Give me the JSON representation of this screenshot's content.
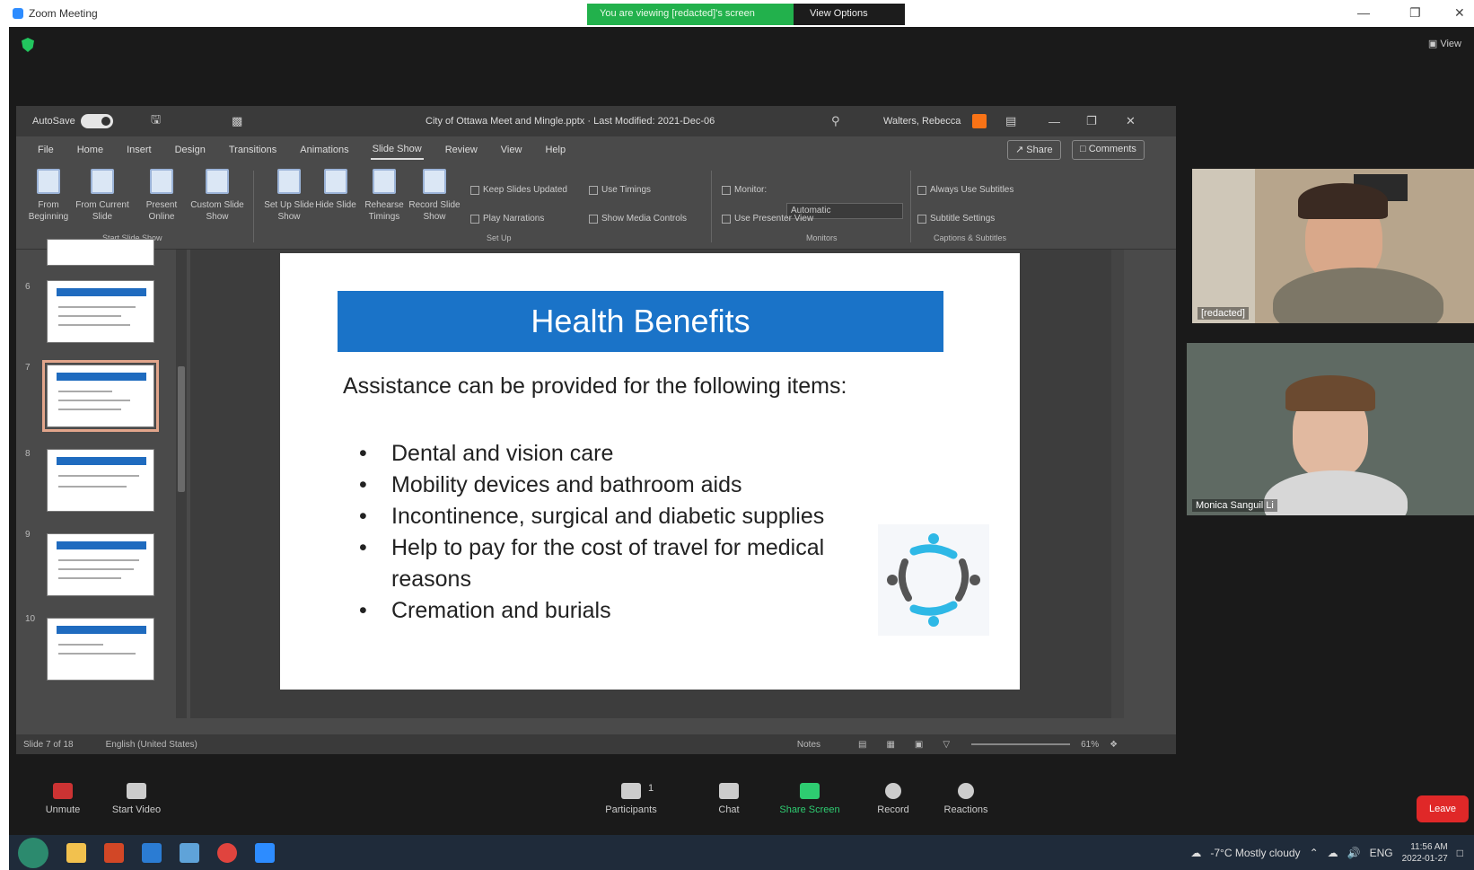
{
  "zoom": {
    "window_title": "Zoom Meeting",
    "share_banner": "You are viewing [redacted]'s screen",
    "view_options": "View Options",
    "view_button": "View",
    "leave": "Leave"
  },
  "ppt": {
    "autosave_label": "AutoSave",
    "autosave_state": "On",
    "doc_name": "City of Ottawa Meet and Mingle.pptx · Last Modified: 2021-Dec-06",
    "user_name": "Walters, Rebecca",
    "tabs": [
      "File",
      "Home",
      "Insert",
      "Design",
      "Transitions",
      "Animations",
      "Slide Show",
      "Review",
      "View",
      "Help"
    ],
    "active_tab": "Slide Show",
    "share_label": "Share",
    "comments_label": "Comments",
    "ribbon": {
      "start": [
        {
          "label": "From Beginning"
        },
        {
          "label": "From Current Slide"
        },
        {
          "label": "Present Online"
        },
        {
          "label": "Custom Slide Show"
        }
      ],
      "setup": [
        {
          "label": "Set Up Slide Show"
        },
        {
          "label": "Hide Slide"
        },
        {
          "label": "Rehearse Timings"
        },
        {
          "label": "Record Slide Show"
        }
      ],
      "checks": {
        "keep_updated": "Keep Slides Updated",
        "use_timings": "Use Timings",
        "play_narrations": "Play Narrations",
        "show_media_controls": "Show Media Controls",
        "monitor": "Monitor:",
        "monitor_value": "Automatic",
        "presenter_view": "Use Presenter View",
        "always_subtitles": "Always Use Subtitles",
        "subtitle_settings": "Subtitle Settings"
      },
      "groups": {
        "start": "Start Slide Show",
        "setup": "Set Up",
        "monitors": "Monitors",
        "captions": "Captions & Subtitles"
      }
    },
    "thumb_numbers": [
      "6",
      "7",
      "8",
      "9",
      "10"
    ],
    "status": {
      "slide_count": "Slide 7 of 18",
      "language": "English (United States)",
      "notes": "Notes",
      "zoom": "61%"
    }
  },
  "slide": {
    "title": "Health Benefits",
    "intro": "Assistance can be provided for the following items:",
    "bullets": [
      "Dental and vision care",
      "Mobility devices and bathroom aids",
      "Incontinence, surgical and diabetic supplies",
      "Help to pay for the cost of travel for medical reasons",
      "Cremation and burials"
    ],
    "colors": {
      "header": "#1a73c8"
    }
  },
  "participants": [
    {
      "name": "[redacted]"
    },
    {
      "name": "Monica Sanguil Li"
    }
  ],
  "toolbar": {
    "unmute": "Unmute",
    "start_video": "Start Video",
    "participants": "Participants",
    "participant_count": "1",
    "chat": "Chat",
    "share_screen": "Share Screen",
    "record": "Record",
    "reactions": "Reactions"
  },
  "taskbar": {
    "weather": "-7°C  Mostly cloudy",
    "lang": "ENG",
    "time": "11:56 AM",
    "date": "2022-01-27"
  }
}
